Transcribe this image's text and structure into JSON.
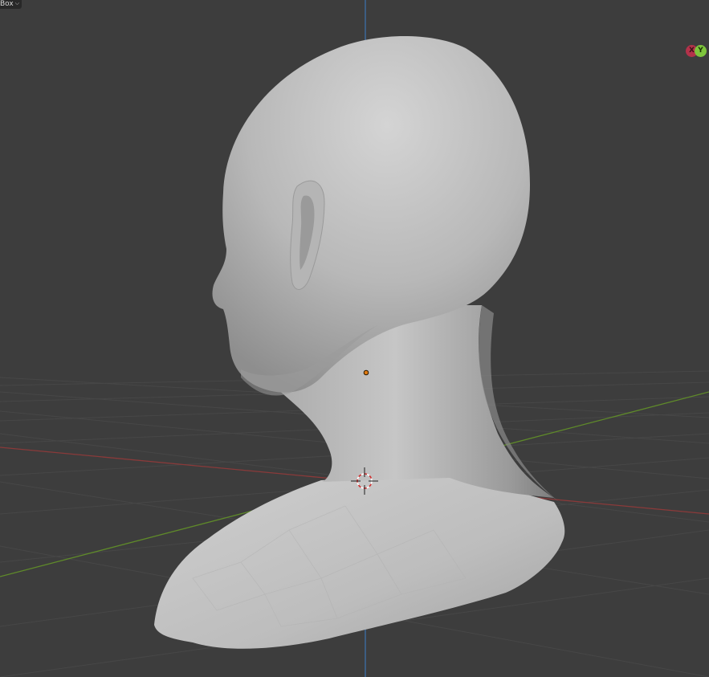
{
  "viewport": {
    "mode_dropdown": {
      "label": "Box",
      "icon": "chevron-down-icon"
    },
    "gizmo": {
      "x_label": "X",
      "y_label": "Y"
    },
    "colors": {
      "background": "#3d3d3d",
      "grid_line": "#484848",
      "x_axis": "#8a3a3a",
      "y_axis": "#5f8a2a",
      "z_axis": "#3c6fa8",
      "mesh_light": "#c9c9c9",
      "mesh_dark": "#7a7a7a",
      "origin_point": "#e07a10",
      "cursor_red": "#d03030"
    }
  }
}
